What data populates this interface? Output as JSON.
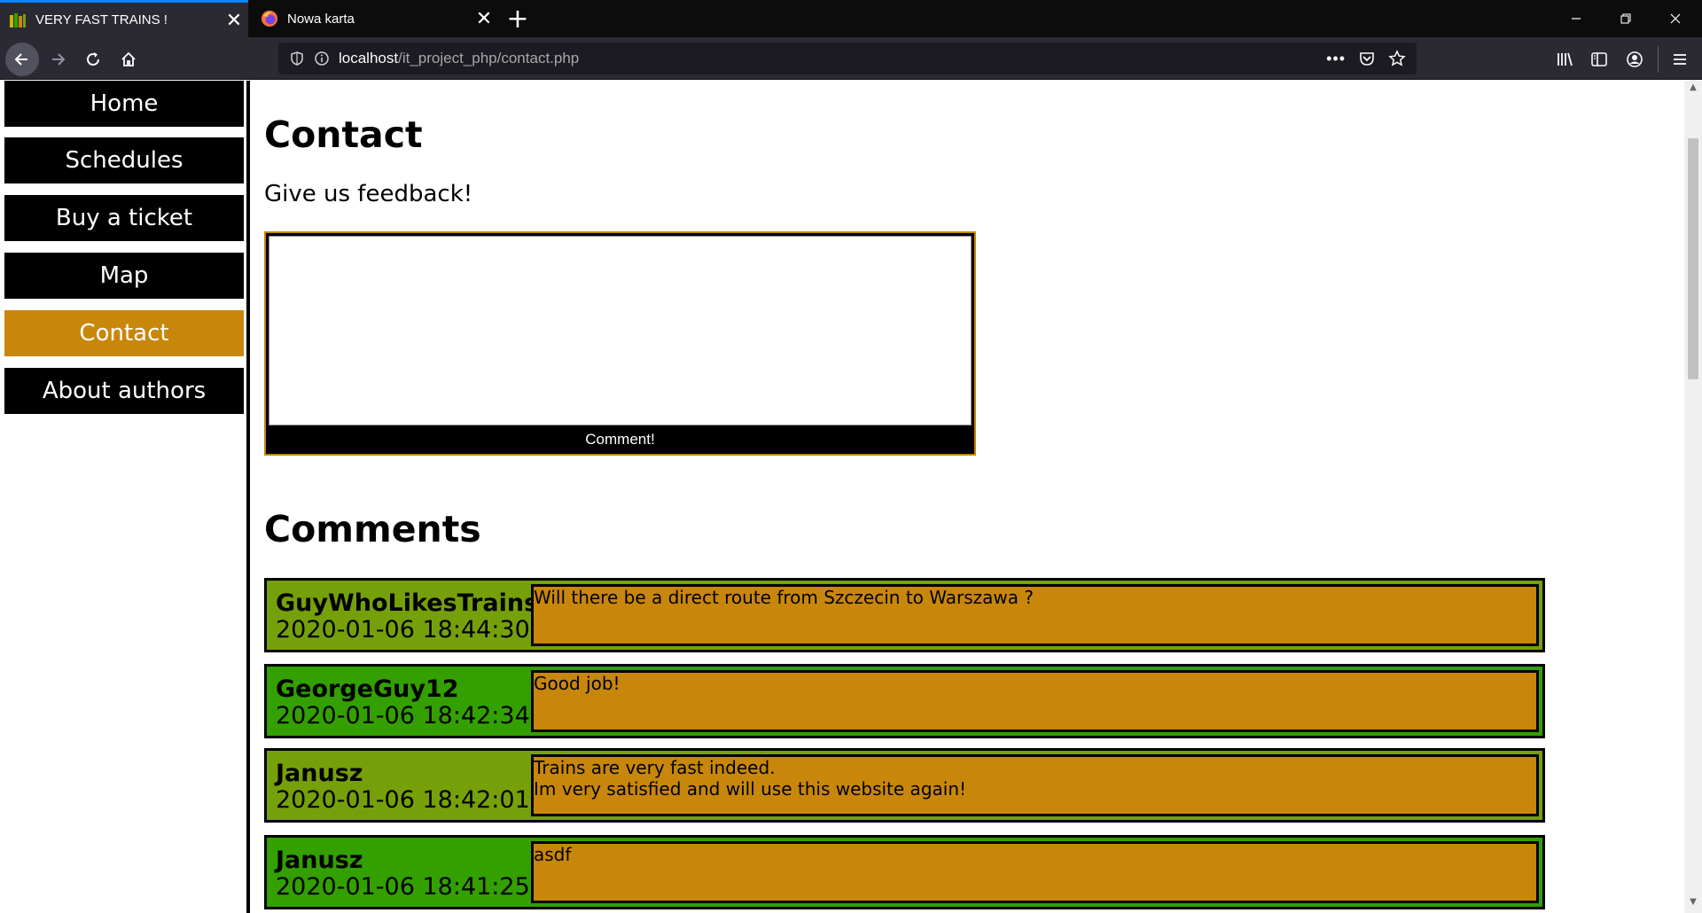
{
  "browser": {
    "tabs": [
      {
        "title": "VERY FAST TRAINS !",
        "active": true
      },
      {
        "title": "Nowa karta",
        "active": false
      }
    ],
    "close_glyph": "✕",
    "new_tab_glyph": "+",
    "url_host": "localhost",
    "url_path": "/it_project_php/contact.php",
    "window_controls": {
      "minimize": "—",
      "restore": "❐",
      "close": "✕"
    }
  },
  "sidebar": {
    "items": [
      {
        "label": "Home",
        "active": false
      },
      {
        "label": "Schedules",
        "active": false
      },
      {
        "label": "Buy a ticket",
        "active": false
      },
      {
        "label": "Map",
        "active": false
      },
      {
        "label": "Contact",
        "active": true
      },
      {
        "label": "About authors",
        "active": false
      }
    ]
  },
  "contact": {
    "title": "Contact",
    "lead": "Give us feedback!",
    "textarea_value": "",
    "submit_label": "Comment!"
  },
  "comments_section": {
    "title": "Comments",
    "items": [
      {
        "user": "GuyWhoLikesTrains",
        "date": "2020-01-06 18:44:30",
        "text": "Will there be a direct route from Szczecin to Warszawa ?",
        "color": "olive"
      },
      {
        "user": "GeorgeGuy12",
        "date": "2020-01-06 18:42:34",
        "text": "Good job!",
        "color": "green"
      },
      {
        "user": "Janusz",
        "date": "2020-01-06 18:42:01",
        "text": "Trains are very fast indeed.\nIm very satisfied and will use this website again!",
        "color": "olive"
      },
      {
        "user": "Janusz",
        "date": "2020-01-06 18:41:25",
        "text": "asdf",
        "color": "green"
      }
    ]
  },
  "colors": {
    "accent": "#c8870b",
    "comment_olive": "#76a00a",
    "comment_green": "#33a000",
    "nav_bg": "#000000"
  }
}
